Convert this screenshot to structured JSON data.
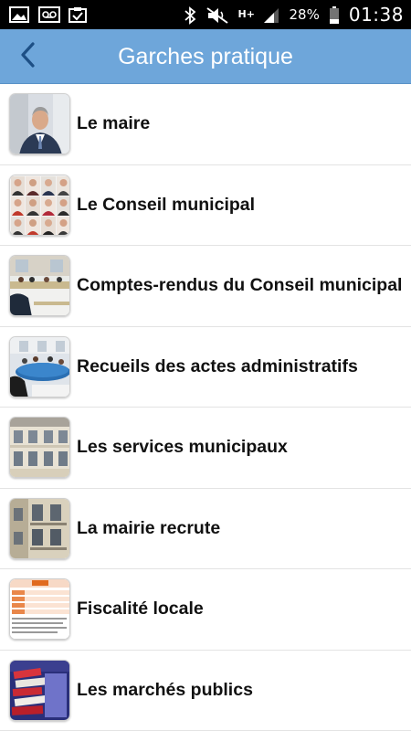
{
  "statusbar": {
    "battery_percent": "28%",
    "network_type": "H+",
    "time": "01:38",
    "icons": [
      "image-icon",
      "voicemail-icon",
      "clipboard-check-icon",
      "bluetooth-icon",
      "mute-icon",
      "signal-icon",
      "battery-icon"
    ]
  },
  "appbar": {
    "title": "Garches pratique",
    "back_icon": "chevron-left-icon",
    "color": "#6ea6da"
  },
  "list": {
    "items": [
      {
        "label": "Le maire",
        "thumb": "mayor-portrait"
      },
      {
        "label": "Le Conseil municipal",
        "thumb": "council-members-grid"
      },
      {
        "label": "Comptes-rendus du Conseil municipal",
        "thumb": "council-meeting-room"
      },
      {
        "label": "Recueils des actes administratifs",
        "thumb": "meeting-table"
      },
      {
        "label": "Les services municipaux",
        "thumb": "town-hall-building"
      },
      {
        "label": "La mairie recrute",
        "thumb": "building-facade"
      },
      {
        "label": "Fiscalité locale",
        "thumb": "tax-table-document"
      },
      {
        "label": "Les marchés publics",
        "thumb": "stacked-folders"
      }
    ]
  }
}
